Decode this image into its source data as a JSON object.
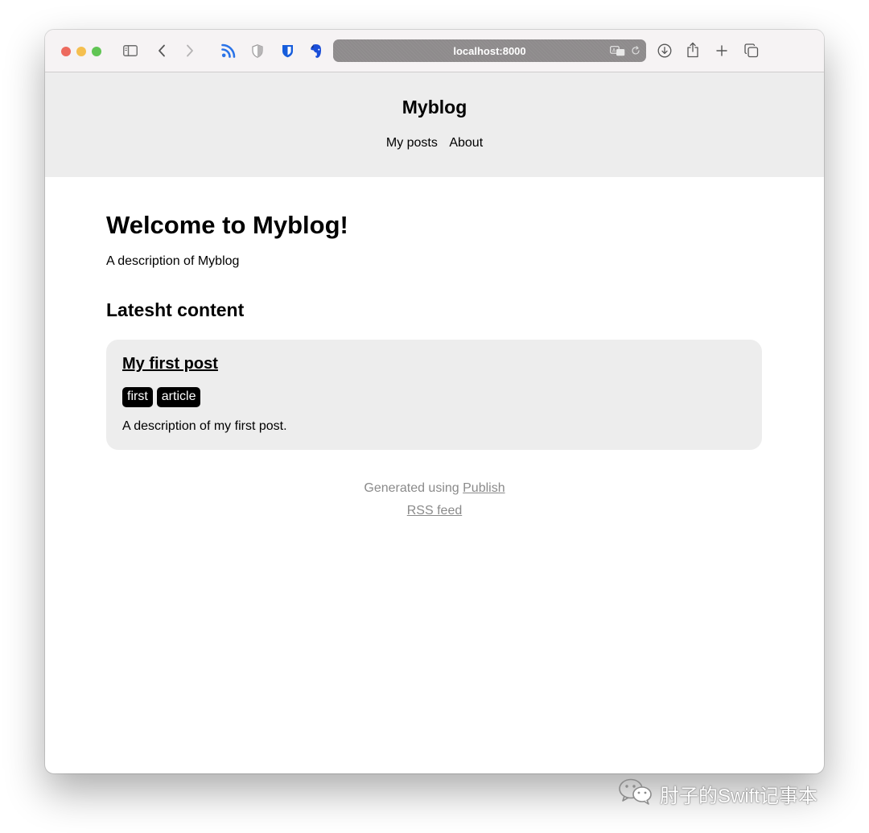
{
  "browser": {
    "address": "localhost:8000",
    "icons": [
      "sidebar-icon",
      "back-icon",
      "forward-icon",
      "rss-icon",
      "shield-icon",
      "bitwarden-icon",
      "evernote-icon",
      "translate-icon",
      "reload-icon",
      "download-icon",
      "share-icon",
      "new-tab-icon",
      "tabs-icon"
    ]
  },
  "site": {
    "name": "Myblog",
    "nav": [
      "My posts",
      "About"
    ]
  },
  "main": {
    "heading": "Welcome to Myblog!",
    "description": "A description of Myblog",
    "latest_heading": "Latesht content",
    "posts": [
      {
        "title": "My first post",
        "tags": [
          "first",
          "article"
        ],
        "description": "A description of my first post."
      }
    ]
  },
  "footer": {
    "generated_prefix": "Generated using ",
    "generated_link": "Publish",
    "rss_link": "RSS feed"
  },
  "watermark": {
    "text": "肘子的Swift记事本"
  },
  "colors": {
    "header_bg": "#ededed",
    "card_bg": "#ededed",
    "tag_bg": "#000000",
    "footer_text": "#8a8a8a"
  }
}
